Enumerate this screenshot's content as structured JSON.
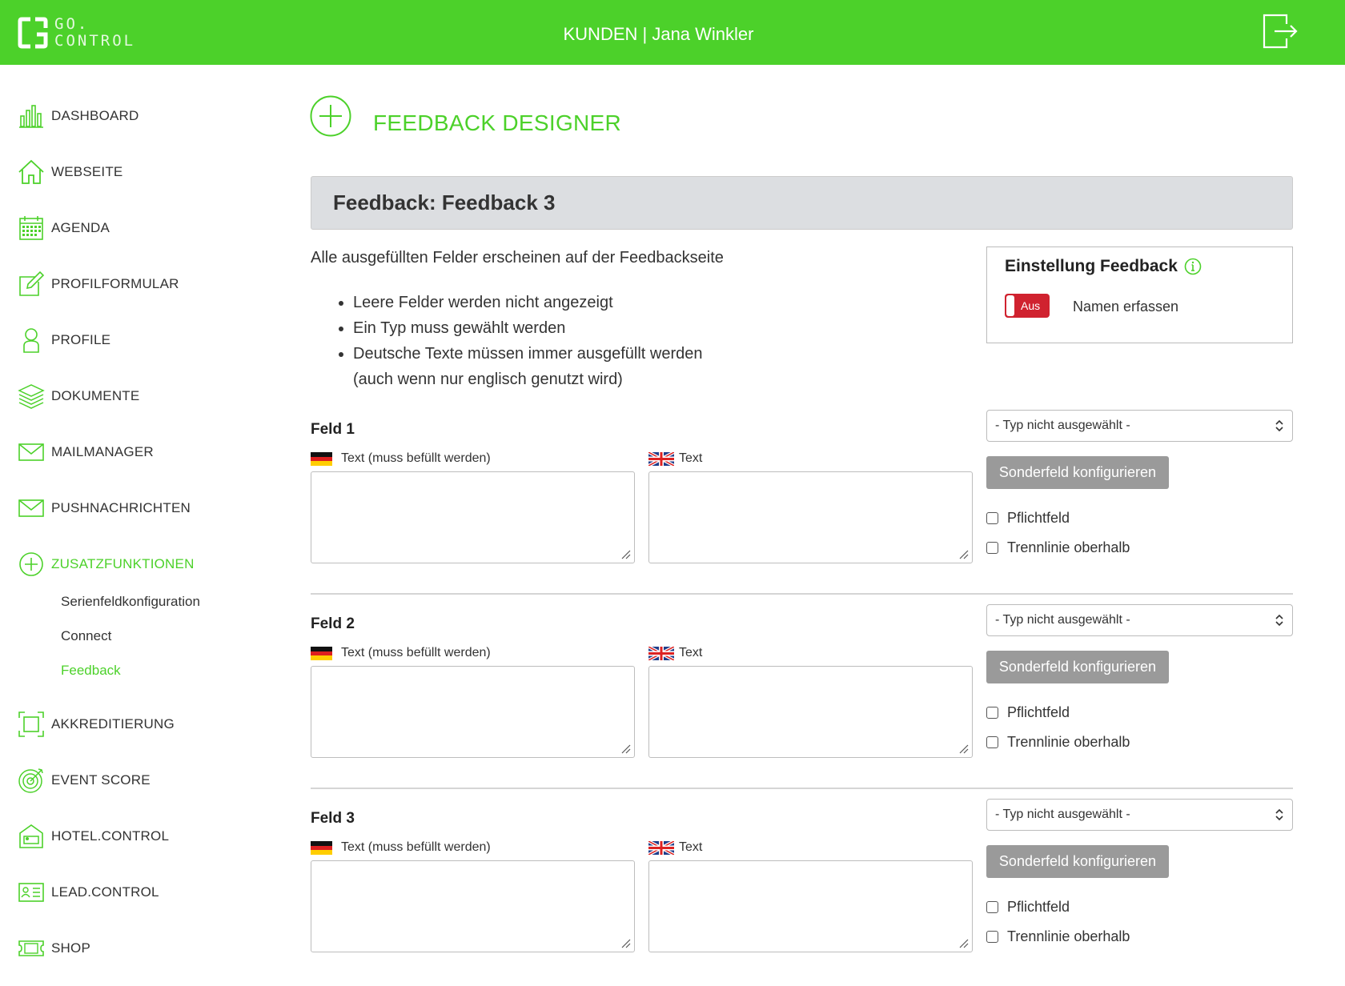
{
  "header": {
    "logo_line1": "GO.",
    "logo_line2": "CONTROL",
    "title": "KUNDEN | Jana Winkler",
    "logout_icon": "logout-icon"
  },
  "sidebar": {
    "items": [
      {
        "label": "DASHBOARD",
        "icon": "bar-chart-icon"
      },
      {
        "label": "WEBSEITE",
        "icon": "home-icon"
      },
      {
        "label": "AGENDA",
        "icon": "calendar-icon"
      },
      {
        "label": "PROFILFORMULAR",
        "icon": "edit-form-icon"
      },
      {
        "label": "PROFILE",
        "icon": "user-icon"
      },
      {
        "label": "DOKUMENTE",
        "icon": "layers-icon"
      },
      {
        "label": "MAILMANAGER",
        "icon": "mail-icon"
      },
      {
        "label": "PUSHNACHRICHTEN",
        "icon": "mail-icon"
      },
      {
        "label": "ZUSATZFUNKTIONEN",
        "icon": "plus-circle-icon",
        "active": true
      },
      {
        "label": "AKKREDITIERUNG",
        "icon": "frame-icon"
      },
      {
        "label": "EVENT SCORE",
        "icon": "target-icon"
      },
      {
        "label": "HOTEL.CONTROL",
        "icon": "hotel-icon"
      },
      {
        "label": "LEAD.CONTROL",
        "icon": "id-card-icon"
      },
      {
        "label": "SHOP",
        "icon": "ticket-icon"
      }
    ],
    "sub_items": [
      {
        "label": "Serienfeldkonfiguration"
      },
      {
        "label": "Connect"
      },
      {
        "label": "Feedback",
        "active": true
      }
    ]
  },
  "main": {
    "title": "FEEDBACK DESIGNER",
    "panel_title": "Feedback: Feedback 3",
    "intro": "Alle ausgefüllten Felder erscheinen auf der Feedbackseite",
    "rules": [
      "Leere Felder werden nicht angezeigt",
      "Ein Typ muss gewählt werden",
      "Deutsche Texte müssen immer ausgefüllt werden"
    ],
    "rules_continuation": "(auch wenn nur englisch genutzt wird)"
  },
  "settings": {
    "title": "Einstellung Feedback",
    "toggle_label": "Aus",
    "toggle_state": "off",
    "toggle_color": "#d0222f",
    "option_label": "Namen erfassen"
  },
  "field_labels": {
    "de_label": "Text (muss befüllt werden)",
    "en_label": "Text",
    "type_placeholder": "- Typ nicht ausgewählt -",
    "sonder_button": "Sonderfeld konfigurieren",
    "required": "Pflichtfeld",
    "separator": "Trennlinie oberhalb"
  },
  "fields": [
    {
      "title": "Feld 1"
    },
    {
      "title": "Feld 2"
    },
    {
      "title": "Feld 3"
    }
  ],
  "colors": {
    "brand": "#4cd12a",
    "panel_bg": "#dcdee1",
    "button_gray": "#9a9a9a",
    "toggle_off": "#d0222f"
  }
}
